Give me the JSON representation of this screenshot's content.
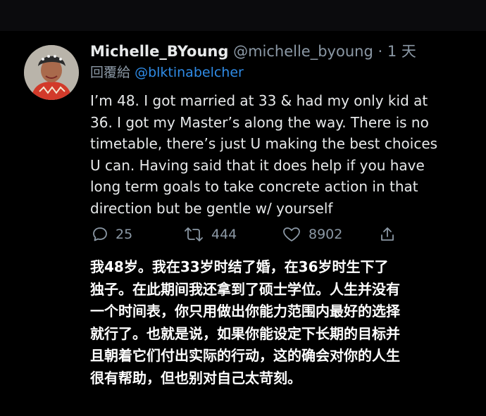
{
  "tweet": {
    "display_name": "Michelle_BYoung",
    "handle": "@michelle_byoung",
    "separator": "·",
    "time": "1 天",
    "reply_prefix": "回覆給",
    "reply_to": "@blktinabelcher",
    "body_lines": [
      "I’m 48. I got married at 33 & had my only kid at",
      "36. I got my Master’s along the way. There is no",
      "timetable, there’s just U making the best choices",
      "U can. Having said that it does help if you have",
      "long term goals to take concrete action in that",
      "direction but be gentle w/ yourself"
    ],
    "actions": {
      "reply_count": "25",
      "retweet_count": "444",
      "like_count": "8902"
    }
  },
  "translation": {
    "lines": [
      "我48岁。我在33岁时结了婚，在36岁时生下了",
      "独子。在此期间我还拿到了硕士学位。人生并没有",
      "一个时间表，你只用做出你能力范围内最好的选择",
      "就行了。也就是说，如果你能设定下长期的目标并",
      "且朝着它们付出实际的行动，这的确会对你的人生",
      "很有帮助，但也别对自己太苛刻。"
    ]
  },
  "icons": {
    "reply": "speech-bubble-icon",
    "retweet": "retweet-icon",
    "like": "heart-icon",
    "share": "share-icon"
  },
  "colors": {
    "background": "#000000",
    "text": "#e7e9ea",
    "muted": "#8b98a5",
    "mention": "#2f8be6"
  }
}
